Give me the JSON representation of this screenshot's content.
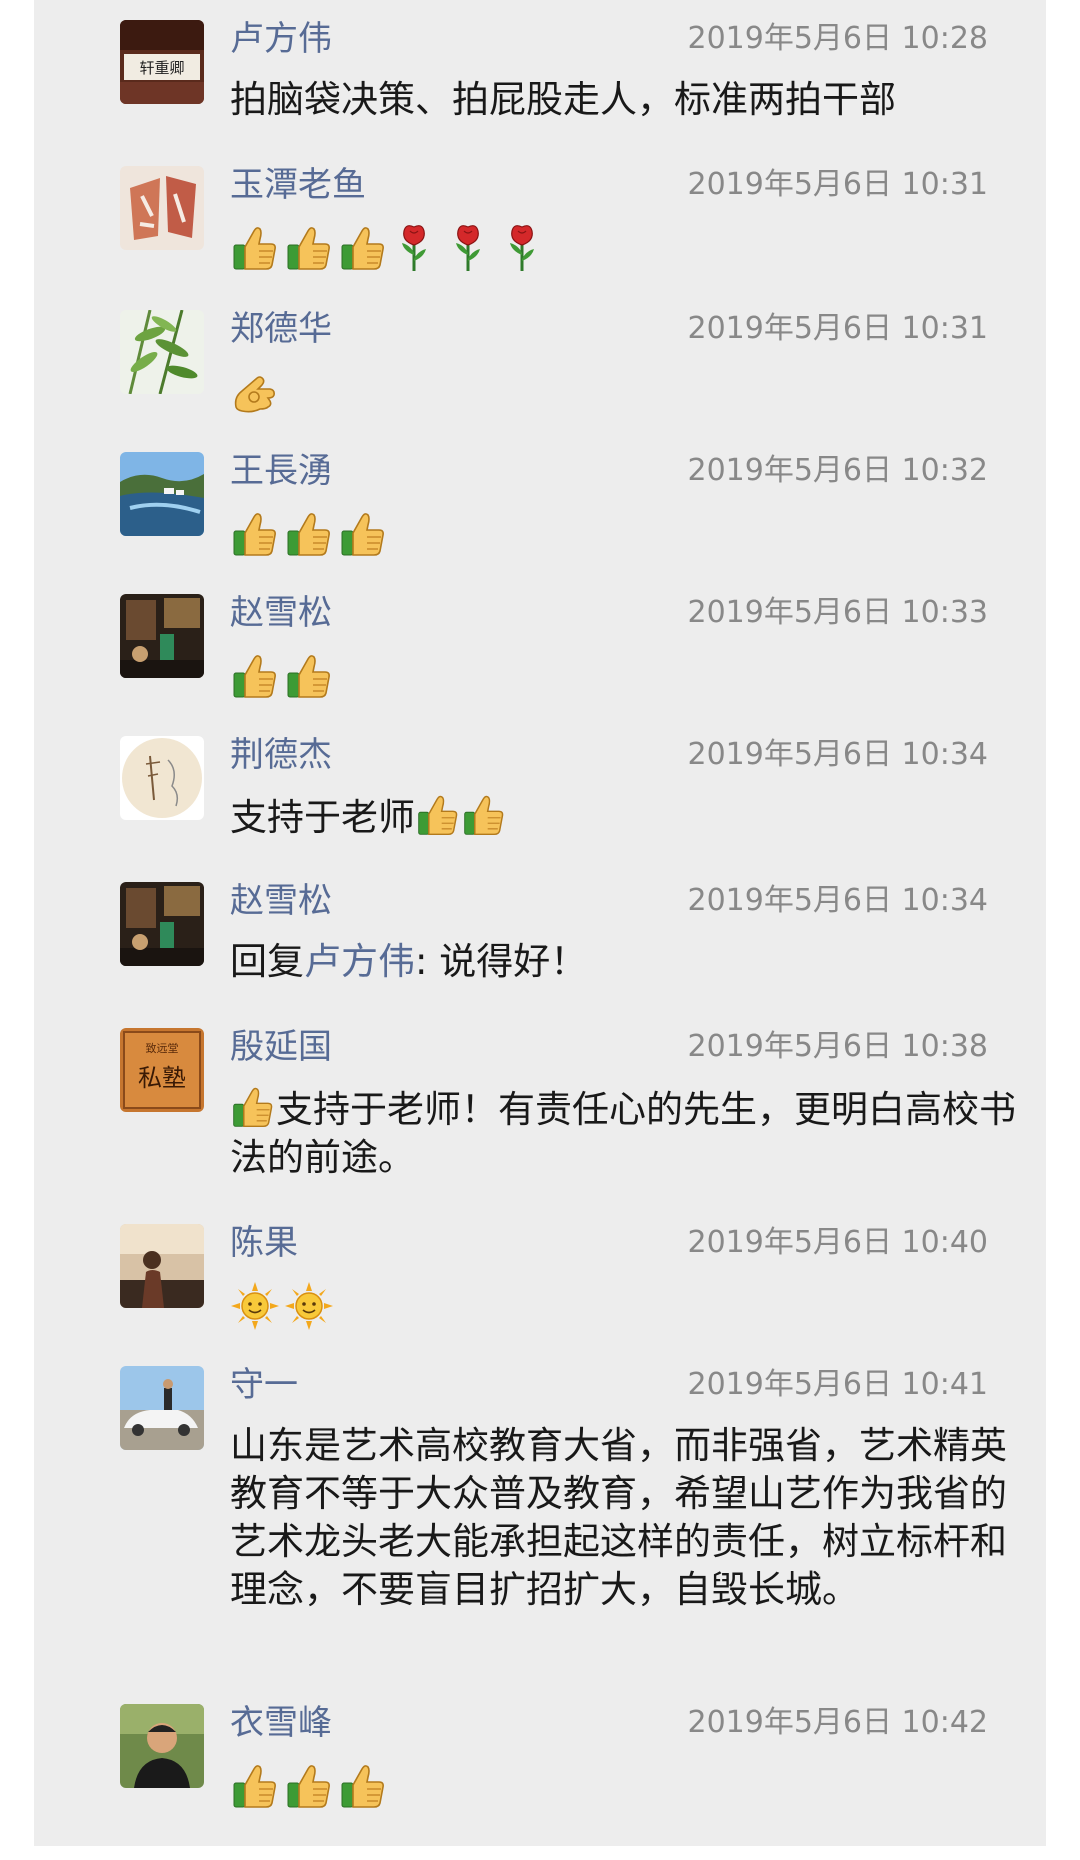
{
  "messages": [
    {
      "name": "卢方伟",
      "time": "2019年5月6日 10:28",
      "text": "拍脑袋决策、拍屁股走人，标准两拍干部"
    },
    {
      "name": "玉潭老鱼",
      "time": "2019年5月6日 10:31",
      "emojis": [
        "thumbs-up",
        "thumbs-up",
        "thumbs-up",
        "rose",
        "rose",
        "rose"
      ]
    },
    {
      "name": "郑德华",
      "time": "2019年5月6日 10:31",
      "emojis": [
        "ok-hand"
      ]
    },
    {
      "name": "王長湧",
      "time": "2019年5月6日 10:32",
      "emojis": [
        "thumbs-up",
        "thumbs-up",
        "thumbs-up"
      ]
    },
    {
      "name": "赵雪松",
      "time": "2019年5月6日 10:33",
      "emojis": [
        "thumbs-up",
        "thumbs-up"
      ]
    },
    {
      "name": "荆德杰",
      "time": "2019年5月6日 10:34",
      "text": "支持于老师",
      "trailing_emojis": [
        "thumbs-up",
        "thumbs-up"
      ]
    },
    {
      "name": "赵雪松",
      "time": "2019年5月6日 10:34",
      "reply_prefix": "回复",
      "reply_to": "卢方伟",
      "reply_text": ": 说得好！"
    },
    {
      "name": "殷延国",
      "time": "2019年5月6日 10:38",
      "leading_emoji": "thumbs-up",
      "text": "支持于老师！有责任心的先生，更明白高校书法的前途。"
    },
    {
      "name": "陈果",
      "time": "2019年5月6日 10:40",
      "emojis": [
        "sun",
        "sun"
      ]
    },
    {
      "name": "守一",
      "time": "2019年5月6日 10:41",
      "text": "山东是艺术高校教育大省，而非强省，艺术精英教育不等于大众普及教育，希望山艺作为我省的艺术龙头老大能承担起这样的责任，树立标杆和理念，不要盲目扩招扩大，自毁长城。"
    },
    {
      "name": "衣雪峰",
      "time": "2019年5月6日 10:42",
      "emojis": [
        "thumbs-up",
        "thumbs-up",
        "thumbs-up"
      ]
    }
  ],
  "avatar_texts": {
    "calligraphy_plaque": "轩重卿",
    "seal_stamp": "私塾",
    "seal_small_text": "致远堂"
  },
  "colors": {
    "name": "#576b95",
    "time": "#888888",
    "text": "#191919",
    "background": "#ededed"
  }
}
